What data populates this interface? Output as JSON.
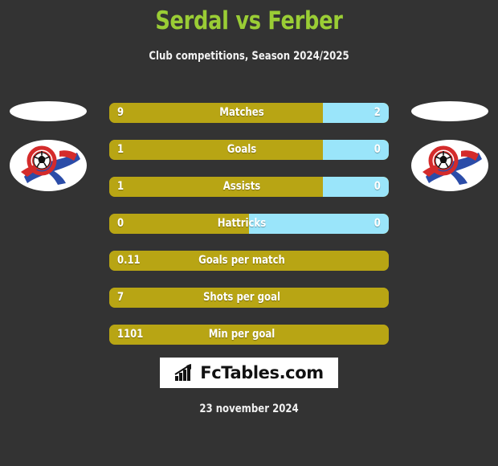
{
  "header": {
    "title": "Serdal vs Ferber",
    "subtitle": "Club competitions, Season 2024/2025",
    "title_color": "#9ACD35"
  },
  "logos": {
    "left": {
      "name": "club-crest-left",
      "alt": "Club crest"
    },
    "right": {
      "name": "club-crest-right",
      "alt": "Club crest"
    }
  },
  "colors": {
    "background": "#333333",
    "home_bar": "#B8A514",
    "away_bar": "#9AE5FA",
    "title": "#9ACD35",
    "text": "#FFFFFF"
  },
  "footer": {
    "brand": "FcTables.com",
    "brand_icon": "bar-chart-up-icon",
    "date": "23 november 2024"
  },
  "chart_data": {
    "type": "bar",
    "title": "Serdal vs Ferber",
    "subtitle": "Club competitions, Season 2024/2025",
    "orientation": "horizontal",
    "style": "diverging-comparison",
    "legend": [
      "Serdal",
      "Ferber"
    ],
    "series": [
      {
        "name": "Serdal",
        "color": "#B8A514",
        "values": [
          9,
          1,
          1,
          0,
          0.11,
          7,
          1101
        ]
      },
      {
        "name": "Ferber",
        "color": "#9AE5FA",
        "values": [
          2,
          0,
          0,
          0,
          null,
          null,
          null
        ]
      }
    ],
    "categories": [
      "Matches",
      "Goals",
      "Assists",
      "Hattricks",
      "Goals per match",
      "Shots per goal",
      "Min per goal"
    ],
    "rows": [
      {
        "label": "Matches",
        "home": "9",
        "away": "2",
        "split": true,
        "home_pct": 76.5
      },
      {
        "label": "Goals",
        "home": "1",
        "away": "0",
        "split": true,
        "home_pct": 76.5
      },
      {
        "label": "Assists",
        "home": "1",
        "away": "0",
        "split": true,
        "home_pct": 76.5
      },
      {
        "label": "Hattricks",
        "home": "0",
        "away": "0",
        "split": true,
        "home_pct": 50.0
      },
      {
        "label": "Goals per match",
        "home": "0.11",
        "away": "",
        "split": false,
        "home_pct": 100
      },
      {
        "label": "Shots per goal",
        "home": "7",
        "away": "",
        "split": false,
        "home_pct": 100
      },
      {
        "label": "Min per goal",
        "home": "1101",
        "away": "",
        "split": false,
        "home_pct": 100
      }
    ]
  }
}
